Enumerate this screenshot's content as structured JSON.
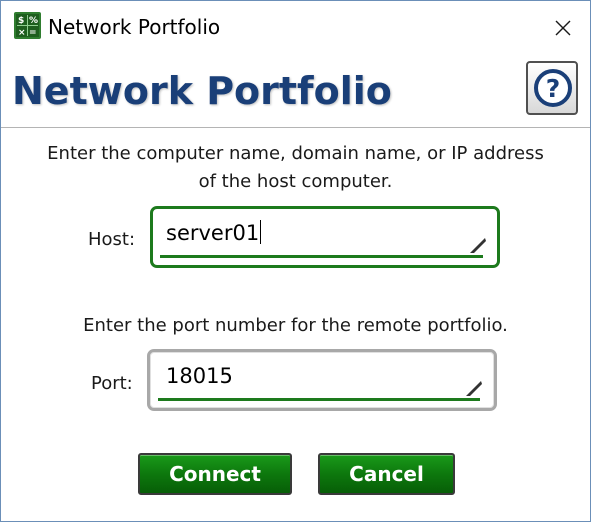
{
  "window": {
    "title": "Network Portfolio",
    "app_icon": "spreadsheet-calculator-icon",
    "close_icon": "close-icon"
  },
  "header": {
    "title": "Network Portfolio",
    "help_icon": "help-question-icon"
  },
  "host": {
    "instruction_line1": "Enter the computer name, domain name, or IP address",
    "instruction_line2": "of the host computer.",
    "label": "Host:",
    "value": "server01"
  },
  "port": {
    "instruction": "Enter the port number for the remote portfolio.",
    "label": "Port:",
    "value": "18015"
  },
  "buttons": {
    "connect": "Connect",
    "cancel": "Cancel"
  },
  "colors": {
    "title_blue": "#1a3f78",
    "accent_green": "#1d7a1d",
    "button_green": "#0d780d"
  }
}
